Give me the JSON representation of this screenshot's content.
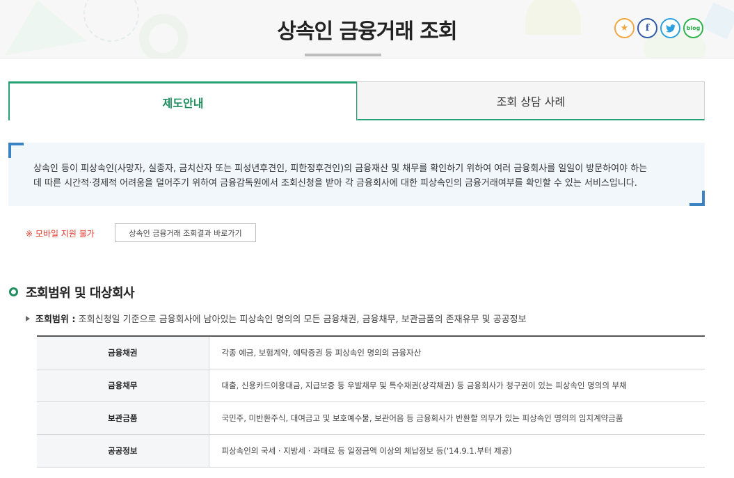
{
  "page": {
    "title": "상속인 금융거래 조회"
  },
  "share": [
    {
      "name": "favorite",
      "glyph": "★"
    },
    {
      "name": "facebook",
      "glyph": "f"
    },
    {
      "name": "twitter",
      "glyph": "t"
    },
    {
      "name": "blog",
      "glyph": "blog"
    }
  ],
  "tabs": [
    {
      "label": "제도안내",
      "active": true
    },
    {
      "label": "조회 상담 사례",
      "active": false
    }
  ],
  "info": {
    "line1": "상속인 등이 피상속인(사망자, 실종자, 금치산자 또는 피성년후견인, 피한정후견인)의 금융재산 및 채무를 확인하기 위하여 여러 금융회사를 일일이 방문하여야 하는",
    "line2": "데 따른 시간적·경제적 어려움을 덜어주기 위하여 금융감독원에서 조회신청을 받아 각 금융회사에 대한 피상속인의 금융거래여부를 확인할 수 있는 서비스입니다."
  },
  "notice": {
    "mobile": "※ 모바일 지원 불가",
    "result_link": "상속인 금융거래 조회결과 바로가기"
  },
  "section": {
    "title": "조회범위 및 대상회사",
    "range_label": "조회범위 :",
    "range_text": " 조회신청일 기준으로 금융회사에 남아있는 피상속인 명의의 모든 금융채권, 금융채무, 보관금품의 존재유무 및 공공정보"
  },
  "table": {
    "rows": [
      {
        "head": "금융채권",
        "desc": "각종 예금, 보험계약, 예탁증권 등 피상속인 명의의 금융자산"
      },
      {
        "head": "금융채무",
        "desc": "대출, 신용카드이용대금, 지급보증 등 우발채무 및 특수채권(상각채권) 등 금융회사가 청구권이 있는 피상속인 명의의 부채"
      },
      {
        "head": "보관금품",
        "desc": "국민주, 미반환주식, 대여금고 및 보호예수물, 보관어음 등 금융회사가 반환할 의무가 있는 피상속인 명의의 임치계약금품"
      },
      {
        "head": "공공정보",
        "desc": "피상속인의 국세 · 지방세 · 과태료 등 일정금액 이상의 체납정보 등('14.9.1.부터 제공)"
      }
    ]
  },
  "colors": {
    "accent": "#26a074",
    "info_bg": "#f2f7fb",
    "corner": "#3b82c4",
    "warning": "#e03a2e"
  }
}
